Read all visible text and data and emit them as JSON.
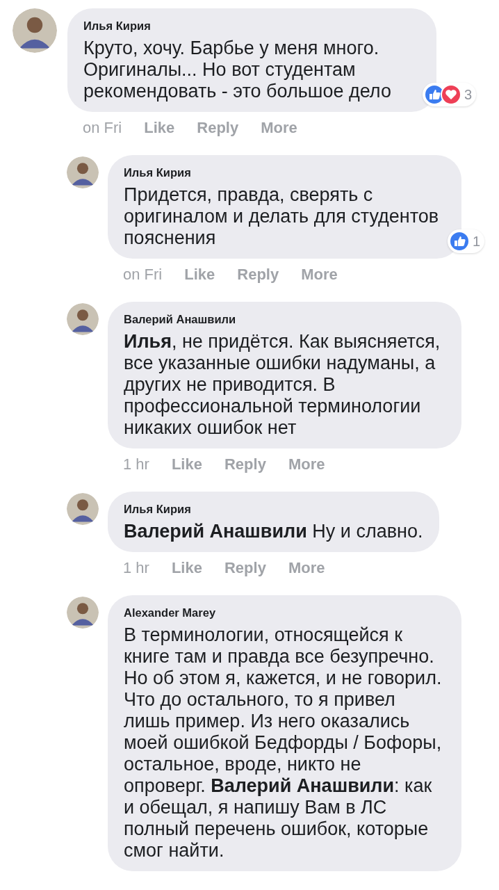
{
  "comments": [
    {
      "author": "Илья Кирия",
      "text": "Круто, хочу. Барбье у меня много. Оригиналы... Но вот студентам рекомендовать - это большое дело",
      "time": "on Fri",
      "actions": [
        "Like",
        "Reply",
        "More"
      ],
      "reactions": [
        {
          "kind": "like"
        },
        {
          "kind": "love"
        }
      ],
      "reaction_count": "3",
      "children": [
        {
          "author": "Илья Кирия",
          "text": "Придется, правда, сверять с оригиналом и делать для студентов пояснения",
          "time": "on Fri",
          "actions": [
            "Like",
            "Reply",
            "More"
          ],
          "reactions": [
            {
              "kind": "like"
            }
          ],
          "reaction_count": "1"
        },
        {
          "author": "Валерий Анашвили",
          "text": "**Илья**, не придётся. Как выясняется, все указанные ошибки надуманы, а других не приводится. В профессиональной терминологии никаких ошибок нет",
          "time": "1 hr",
          "actions": [
            "Like",
            "Reply",
            "More"
          ]
        },
        {
          "author": "Илья Кирия",
          "text": "**Валерий Анашвили** Ну и славно.",
          "time": "1 hr",
          "actions": [
            "Like",
            "Reply",
            "More"
          ]
        },
        {
          "author": "Alexander Marey",
          "text": "В терминологии, относящейся к книге там и правда все безупречно. Но об этом я, кажется, и не говорил. Что до остального, то я привел лишь пример. Из него оказались моей ошибкой Бедфорды / Бофоры, остальное, вроде, никто не опроверг. **Валерий Анашвили**: как и обещал, я напишу Вам в ЛС полный перечень ошибок, которые смог найти."
        }
      ]
    }
  ]
}
